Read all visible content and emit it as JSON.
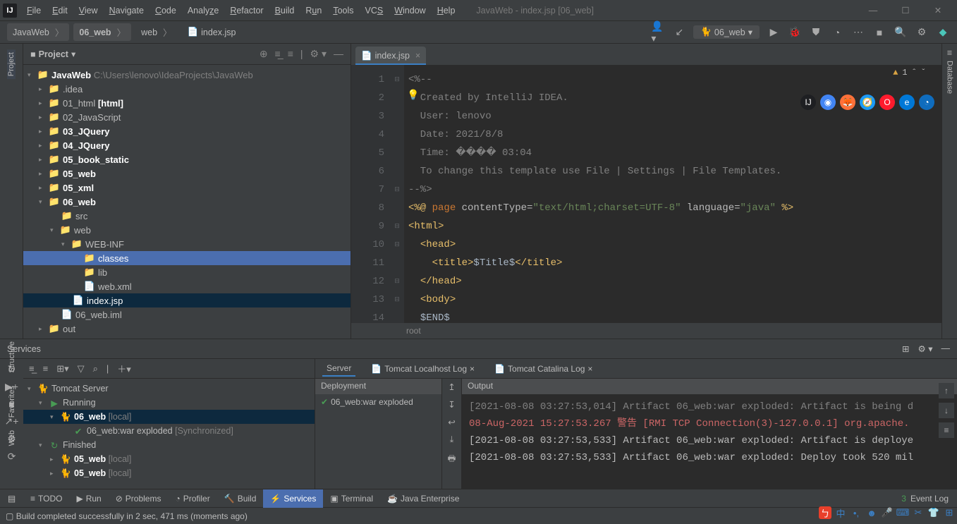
{
  "window": {
    "title": "JavaWeb - index.jsp [06_web]"
  },
  "menu": [
    "File",
    "Edit",
    "View",
    "Navigate",
    "Code",
    "Analyze",
    "Refactor",
    "Build",
    "Run",
    "Tools",
    "VCS",
    "Window",
    "Help"
  ],
  "breadcrumb": {
    "b1": "JavaWeb",
    "b2": "06_web",
    "b3": "web",
    "b4": "index.jsp"
  },
  "run_config": "06_web",
  "project_panel": {
    "title": "Project",
    "tree": {
      "root_name": "JavaWeb",
      "root_path": "C:\\Users\\lenovo\\IdeaProjects\\JavaWeb",
      "items": [
        ".idea",
        "01_html",
        "02_JavaScript",
        "03_JQuery",
        "04_JQuery",
        "05_book_static",
        "05_web",
        "05_xml",
        "06_web"
      ],
      "html_suffix": "[html]",
      "sub_src": "src",
      "sub_web": "web",
      "sub_webinf": "WEB-INF",
      "sub_classes": "classes",
      "sub_lib": "lib",
      "sub_webxml": "web.xml",
      "sub_index": "index.jsp",
      "sub_iml": "06_web.iml",
      "sub_out": "out"
    }
  },
  "tab": {
    "file": "index.jsp"
  },
  "warnings": "1",
  "code": {
    "l1": "<%--",
    "l2": "  Created by IntelliJ IDEA.",
    "l3": "  User: lenovo",
    "l4": "  Date: 2021/8/8",
    "l5": "  Time: ���� 03:04",
    "l6": "  To change this template use File | Settings | File Templates.",
    "l7": "--%>",
    "l8_a": "<%@ ",
    "l8_page": "page",
    "l8_b": " contentType=",
    "l8_ct": "\"text/html;charset=UTF-8\"",
    "l8_c": " language=",
    "l8_lang": "\"java\"",
    "l8_d": " %>",
    "l9": "<html>",
    "l10": "<head>",
    "l11_a": "    <title>",
    "l11_b": "$Title$",
    "l11_c": "</title>",
    "l12": "</head>",
    "l13": "<body>",
    "l14": "$END$"
  },
  "breadcrumb_bottom": "root",
  "services": {
    "title": "Services",
    "tree": {
      "tomcat": "Tomcat Server",
      "running": "Running",
      "app": "06_web",
      "local": "[local]",
      "artifact": "06_web:war exploded",
      "sync": "[Synchronized]",
      "finished": "Finished",
      "f1": "05_web",
      "f2": "05_web",
      "flocal": "[local]"
    },
    "tabs": {
      "server": "Server",
      "t1": "Tomcat Localhost Log",
      "t2": "Tomcat Catalina Log"
    },
    "dep_head": "Deployment",
    "dep_item": "06_web:war exploded",
    "out_head": "Output",
    "console": {
      "c0": "[2021-08-08 03:27:53,014] Artifact 06_web:war exploded: Artifact is being d",
      "c1": "08-Aug-2021 15:27:53.267 警告 [RMI TCP Connection(3)-127.0.0.1] org.apache.",
      "c2": "[2021-08-08 03:27:53,533] Artifact 06_web:war exploded: Artifact is deploye",
      "c3": "[2021-08-08 03:27:53,533] Artifact 06_web:war exploded: Deploy took 520 mil"
    }
  },
  "bottom": {
    "todo": "TODO",
    "run": "Run",
    "problems": "Problems",
    "profiler": "Profiler",
    "build": "Build",
    "services": "Services",
    "terminal": "Terminal",
    "jee": "Java Enterprise",
    "eventlog": "Event Log",
    "eventcount": "3"
  },
  "status": "Build completed successfully in 2 sec, 471 ms (moments ago)"
}
